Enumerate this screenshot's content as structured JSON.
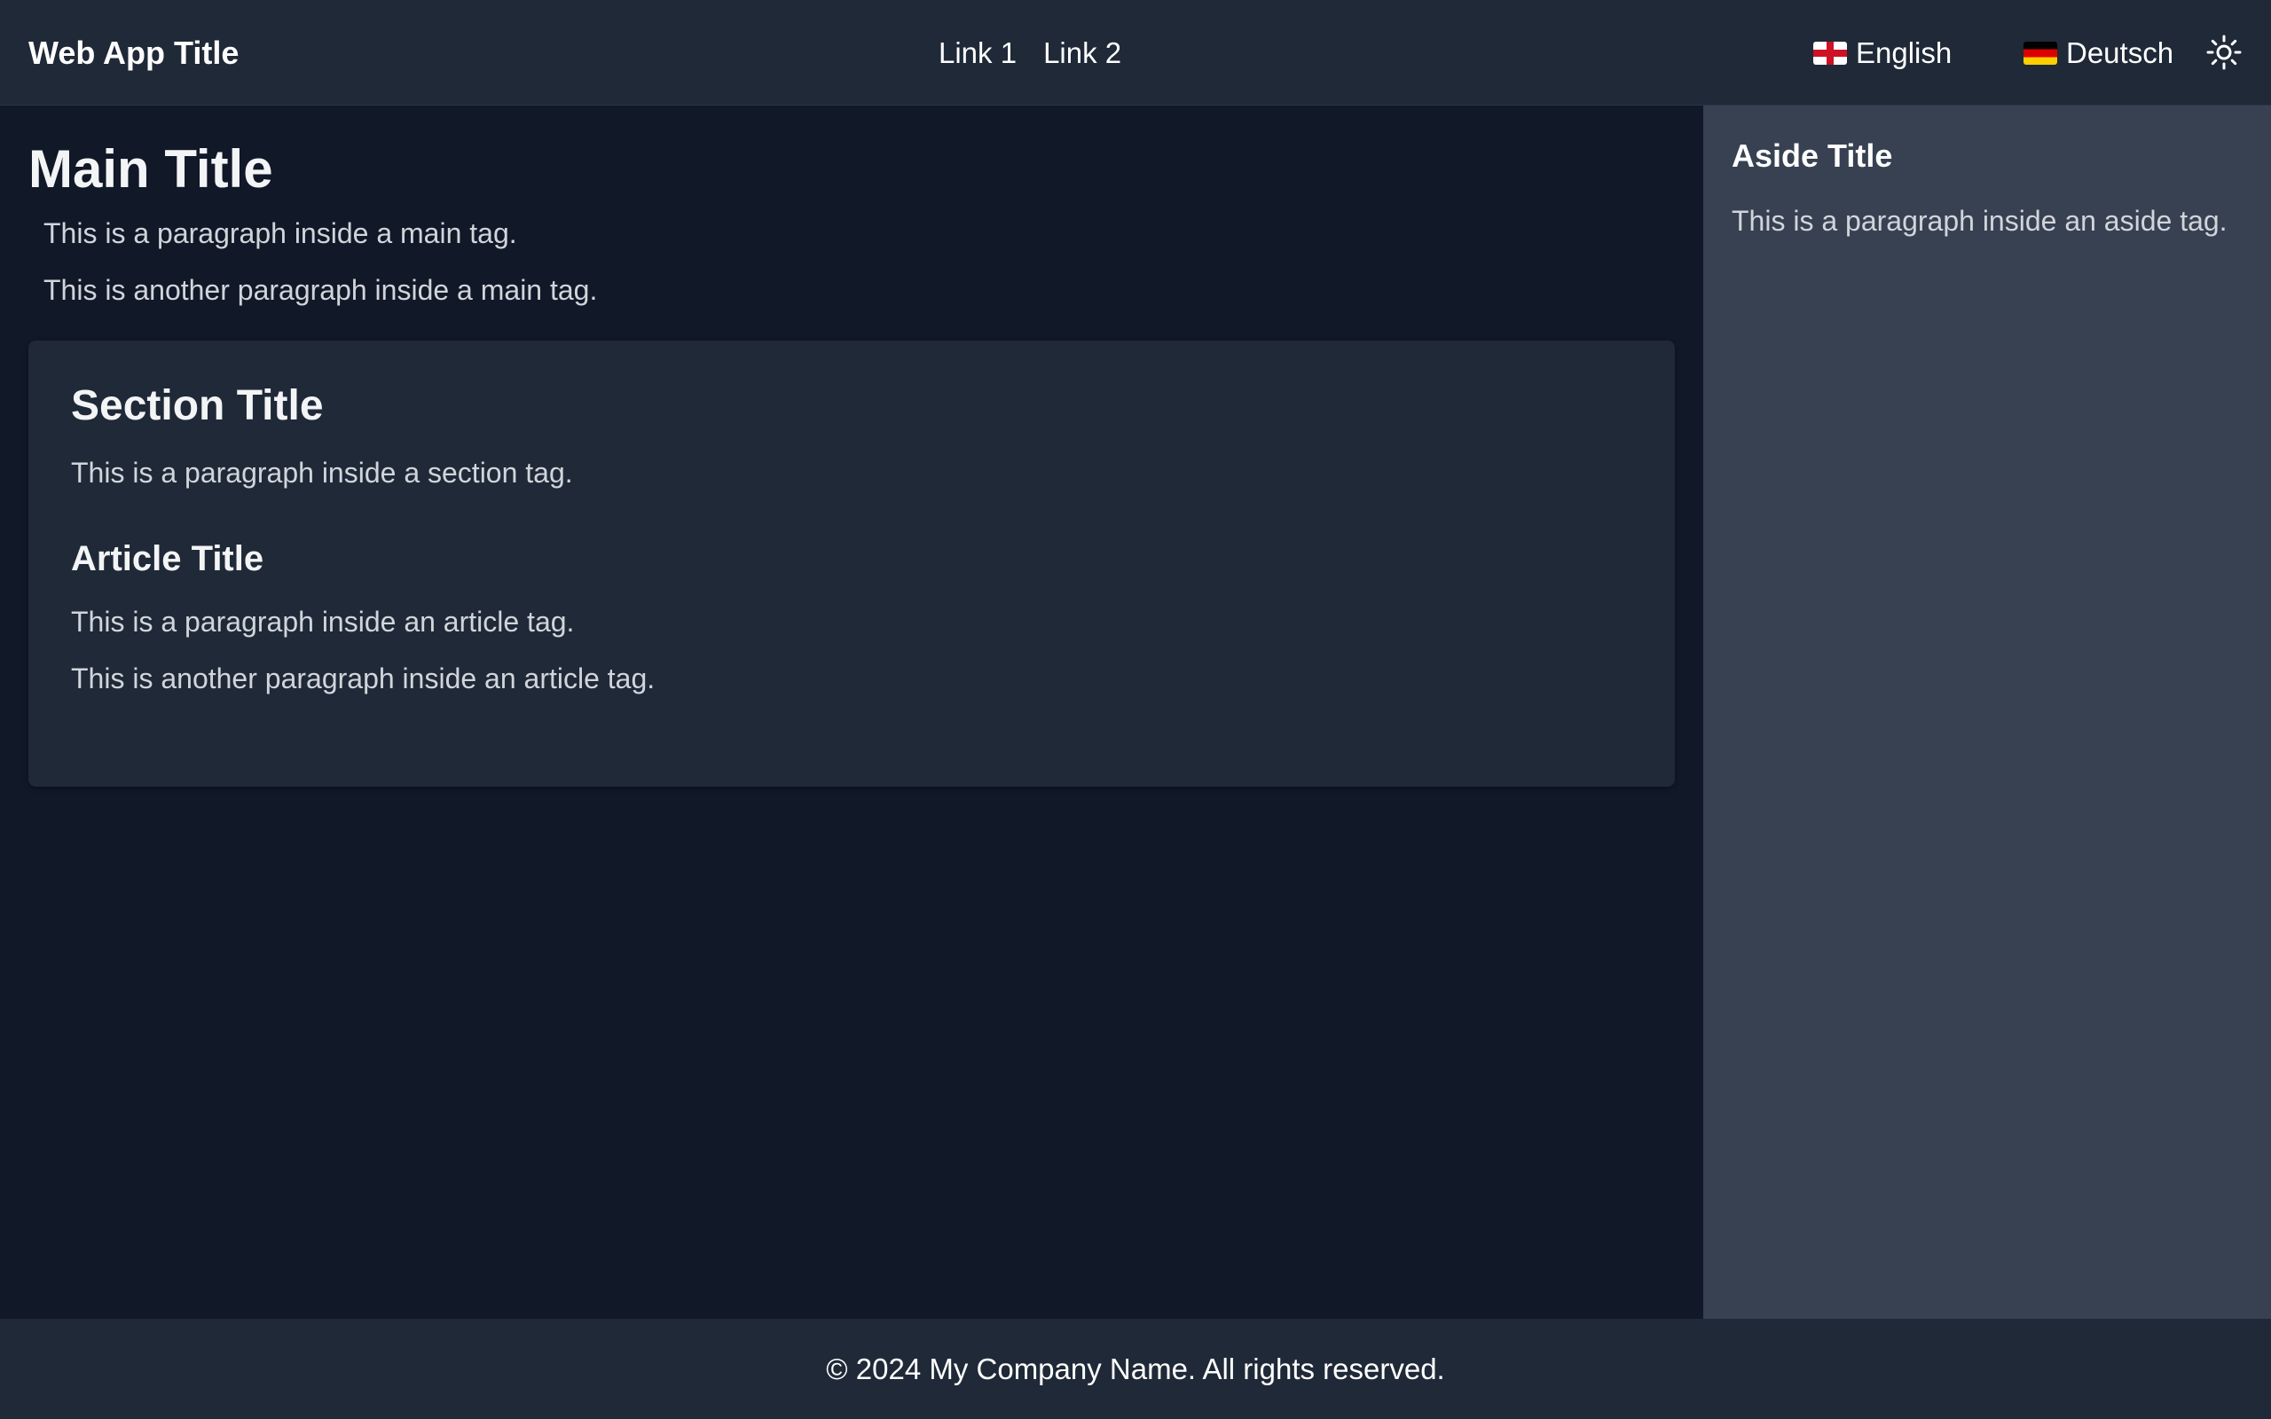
{
  "header": {
    "app_title": "Web App Title",
    "nav": [
      {
        "label": "Link 1"
      },
      {
        "label": "Link 2"
      }
    ],
    "languages": [
      {
        "label": "English",
        "flag": "england-flag-icon"
      },
      {
        "label": "Deutsch",
        "flag": "germany-flag-icon"
      }
    ],
    "theme_toggle_icon": "sun-icon"
  },
  "main": {
    "title": "Main Title",
    "paragraphs": [
      "This is a paragraph inside a main tag.",
      "This is another paragraph inside a main tag."
    ],
    "section": {
      "title": "Section Title",
      "paragraph": "This is a paragraph inside a section tag.",
      "article": {
        "title": "Article Title",
        "paragraphs": [
          "This is a paragraph inside an article tag.",
          "This is another paragraph inside an article tag."
        ]
      }
    }
  },
  "aside": {
    "title": "Aside Title",
    "paragraph": "This is a paragraph inside an aside tag."
  },
  "footer": {
    "text": "© 2024 My Company Name. All rights reserved."
  },
  "colors": {
    "background": "#111827",
    "header_bg": "#1f2937",
    "aside_bg": "#374151",
    "section_bg": "#1f2937",
    "text_primary": "#ffffff",
    "text_secondary": "#d1d5db"
  }
}
